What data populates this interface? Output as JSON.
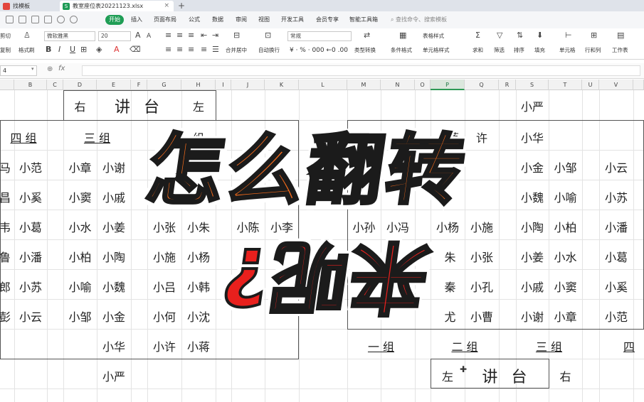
{
  "tabs": {
    "home": "找模板",
    "file": "教室座位表20221123.xlsx",
    "plus": "+"
  },
  "menubar": {
    "start": "开始",
    "items": [
      "插入",
      "页面布局",
      "公式",
      "数据",
      "审阅",
      "视图",
      "开发工具",
      "会员专享",
      "智能工具箱"
    ],
    "search": "查找命令、搜索模板"
  },
  "ribbon": {
    "cut": "剪切",
    "copy": "复制",
    "format_painter": "格式刷",
    "font_name": "微软雅黑",
    "font_size": "20",
    "bold": "B",
    "italic": "I",
    "underline": "U",
    "merge": "合并居中",
    "wrap": "自动换行",
    "number_format": "常规",
    "type_convert": "类型转换",
    "conditional": "条件格式",
    "table_style": "表格样式",
    "cell_style": "单元格样式",
    "sum": "求和",
    "filter": "筛选",
    "sort": "排序",
    "fill": "填充",
    "cell": "单元格",
    "rowcol": "行和列",
    "sheet": "工作表"
  },
  "formula": {
    "namebox": "4",
    "fx": "fx"
  },
  "columns": [
    "B",
    "C",
    "D",
    "E",
    "F",
    "G",
    "H",
    "I",
    "J",
    "K",
    "L",
    "M",
    "N",
    "O",
    "P",
    "Q",
    "R",
    "S",
    "T",
    "U",
    "V"
  ],
  "selected_column": "P",
  "sheet": {
    "lectern_top": "讲 台",
    "right_top": "右",
    "left_top": "左",
    "group4_top": "四 组",
    "group3_top": "三 组",
    "group2_top_partial": "组",
    "group_hidden": "二",
    "seat_jiang": "小蒋",
    "seat_xu": "许",
    "yan_top": "小严",
    "hua_top": "小华",
    "left_block": {
      "col_a": [
        "马",
        "昌",
        "韦",
        "鲁",
        "郎",
        "彭"
      ],
      "col_b": [
        "小范",
        "小奚",
        "小葛",
        "小潘",
        "小苏",
        "小云"
      ],
      "col_d": [
        "小章",
        "小窦",
        "小水",
        "小柏",
        "小喻",
        "小邹"
      ],
      "col_e": [
        "小谢",
        "小戚",
        "小姜",
        "小陶",
        "小魏",
        "小金",
        "小华",
        "小严"
      ]
    },
    "mid_block": {
      "col_g": [
        "小张",
        "小施",
        "小吕",
        "小何",
        "小许"
      ],
      "col_h": [
        "小朱",
        "小杨",
        "小韩",
        "小沈",
        "小蒋"
      ],
      "col_j": [
        "小陈"
      ],
      "col_k": [
        "小李"
      ],
      "col_m": [
        "小孙"
      ],
      "col_n": [
        "小冯"
      ]
    },
    "right_block": {
      "col_p": [
        "小杨",
        "朱",
        "秦",
        "尤"
      ],
      "col_q": [
        "小施",
        "小张",
        "小孔",
        "小曹"
      ],
      "col_s": [
        "小金",
        "小魏",
        "小陶",
        "小姜",
        "小戚",
        "小谢"
      ],
      "col_t": [
        "小邹",
        "小喻",
        "小柏",
        "小水",
        "小窦",
        "小章"
      ],
      "col_v": [
        "小云",
        "小苏",
        "小潘",
        "小葛",
        "小奚",
        "小范"
      ]
    },
    "groups_bottom": [
      "一 组",
      "二 组",
      "三 组",
      "四"
    ],
    "lectern_bottom": "讲 台",
    "left_bottom": "左",
    "right_bottom": "右"
  },
  "overlay": {
    "line1": "怎么翻转",
    "line2": "来呢?",
    "color1": "#f26a1b",
    "color2": "#e8201d"
  }
}
